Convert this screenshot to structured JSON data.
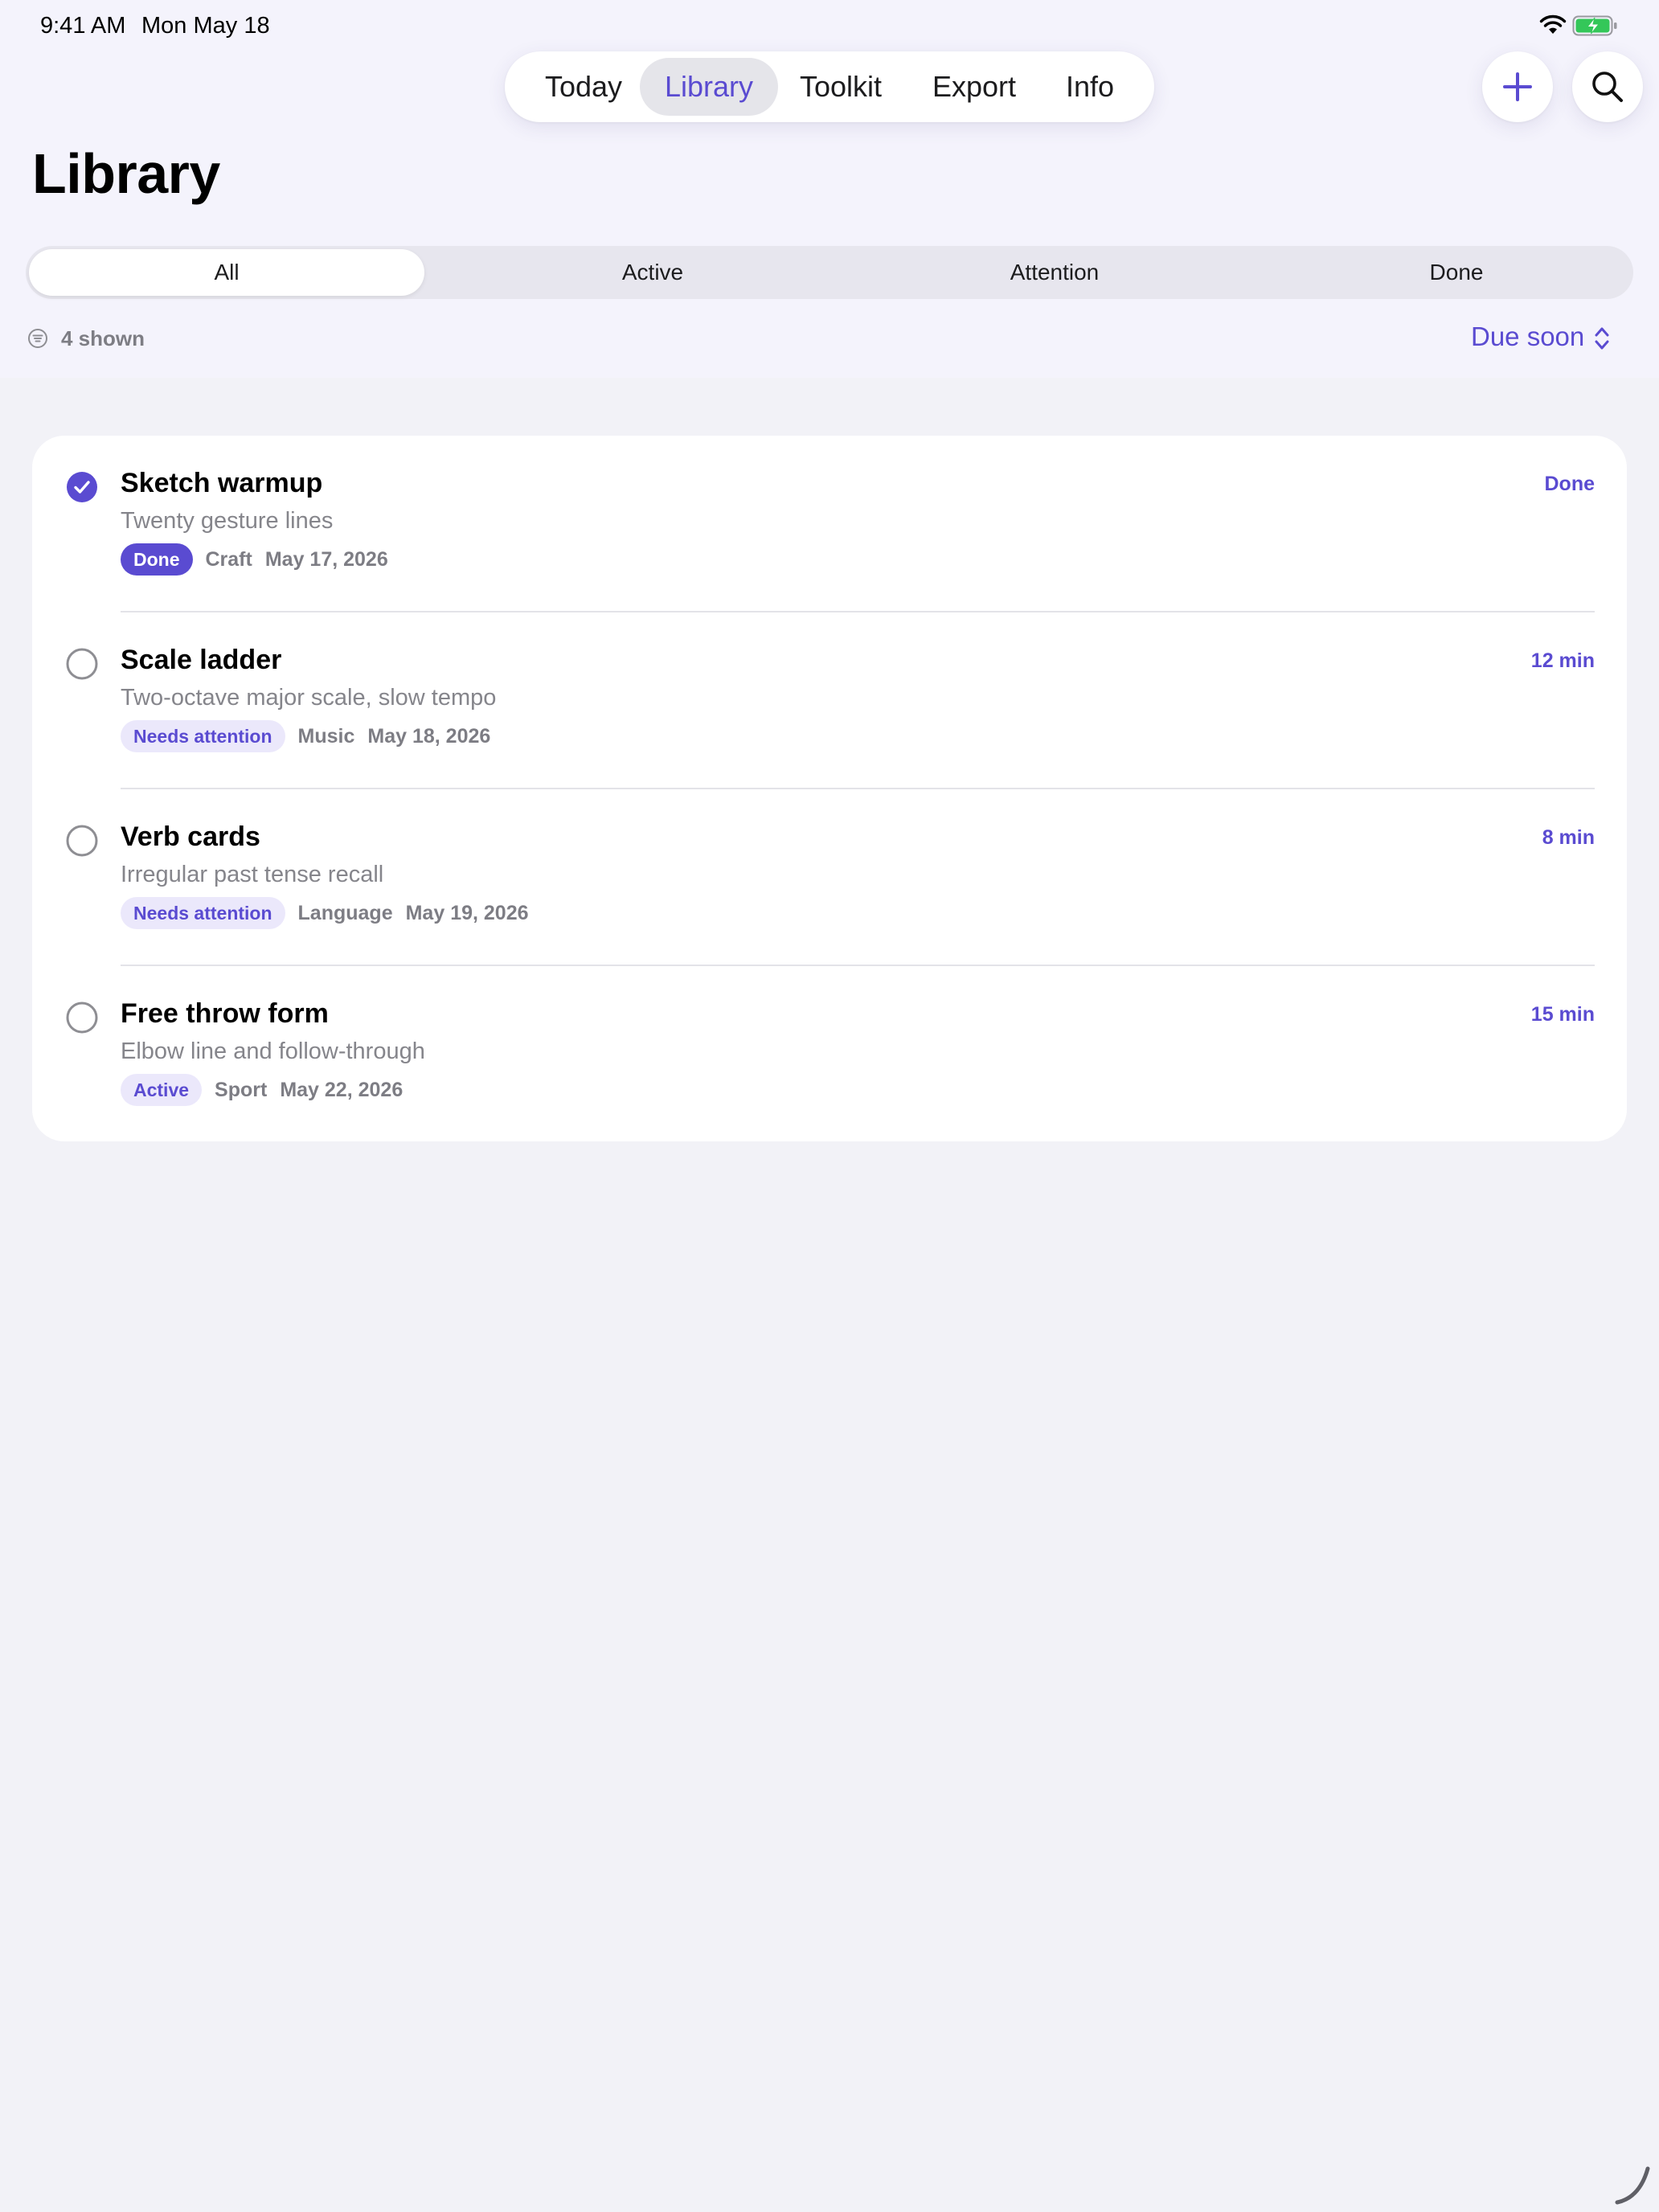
{
  "status_bar": {
    "time": "9:41 AM",
    "date": "Mon May 18",
    "wifi_icon": "wifi-icon",
    "battery_icon": "battery-charging-icon"
  },
  "tabs": [
    {
      "label": "Today",
      "selected": false
    },
    {
      "label": "Library",
      "selected": true
    },
    {
      "label": "Toolkit",
      "selected": false
    },
    {
      "label": "Export",
      "selected": false
    },
    {
      "label": "Info",
      "selected": false
    }
  ],
  "actions": {
    "add_icon": "plus-icon",
    "search_icon": "search-icon"
  },
  "page_title": "Library",
  "filter": {
    "segments": [
      {
        "label": "All",
        "selected": true
      },
      {
        "label": "Active",
        "selected": false
      },
      {
        "label": "Attention",
        "selected": false
      },
      {
        "label": "Done",
        "selected": false
      }
    ]
  },
  "list_info": {
    "shown_label": "4 shown",
    "sort_label": "Due soon"
  },
  "items": [
    {
      "title": "Sketch warmup",
      "subtitle": "Twenty gesture lines",
      "badge": "Done",
      "category": "Craft",
      "date": "May 17, 2026",
      "right": "Done",
      "checked": true
    },
    {
      "title": "Scale ladder",
      "subtitle": "Two-octave major scale, slow tempo",
      "badge": "Needs attention",
      "category": "Music",
      "date": "May 18, 2026",
      "right": "12 min",
      "checked": false
    },
    {
      "title": "Verb cards",
      "subtitle": "Irregular past tense recall",
      "badge": "Needs attention",
      "category": "Language",
      "date": "May 19, 2026",
      "right": "8 min",
      "checked": false
    },
    {
      "title": "Free throw form",
      "subtitle": "Elbow line and follow-through",
      "badge": "Active",
      "category": "Sport",
      "date": "May 22, 2026",
      "right": "15 min",
      "checked": false
    }
  ],
  "colors": {
    "accent": "#5a4bd1",
    "accent_soft": "#ebe8fb",
    "background": "#f2f2f7",
    "header_background": "#f4f3fc",
    "battery_green": "#34c759"
  }
}
